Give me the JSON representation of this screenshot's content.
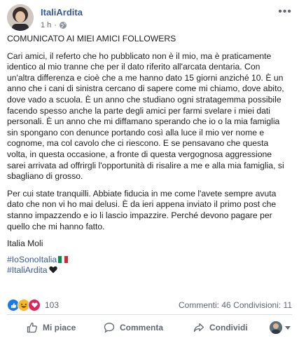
{
  "post": {
    "author": "ItaliArdita",
    "time": "1 h",
    "separator": "·",
    "headline": "COMUNICATO AI MIEI AMICI FOLLOWERS",
    "paragraph1": "Cari amici, il referto che ho pubblicato non è il mio, ma è praticamente identico al mio tranne che per il dato riferito all'arcata dentaria. Con un'altra differenza e cioè che a me hanno dato 15 giorni anziché 10. È un anno che i cani di sinistra cercano di sapere come mi chiamo, dove abito, dove vado a scuola. È un anno che studiano ogni stratagemma possibile facendo spesso anche la parte degli amici per farmi svelare i miei dati personali. È un anno che mi diffamano sperando che io o la mia famiglia sin spongano con denunce portando così alla luce il mio ver nome e cognome, ma col cavolo che ci riescono. E se pensavano che questa volta, in questa occasione, a fronte di questa vergognosa aggressione sarei arrivata ad offrirgli l'opportunità di risalire a me e alla mia famiglia, si sbagliano di grosso.",
    "paragraph2": "Per cui state tranquilli. Abbiate fiducia in me come l'avete sempre avuta dato che non vi ho mai delusi. È da ieri appena inviato il primo post che stanno impazzendo e io li lascio impazzire. Perché devono pagare per quello che mi hanno fatto.",
    "signature": "Italia Moli",
    "hashtags": [
      "#IoSonoItalia",
      "#ItaliArdita"
    ]
  },
  "stats": {
    "reactions_count": "103",
    "comments": "Commenti: 46",
    "shares": "Condivisioni: 11"
  },
  "actions": {
    "like": "Mi piace",
    "comment": "Commenta",
    "share": "Condividi"
  },
  "icons": {
    "more": "more-options-icon",
    "privacy": "globe-icon",
    "like": "thumbs-up-icon",
    "comment": "speech-bubble-icon",
    "share": "share-arrow-icon"
  },
  "colors": {
    "link": "#385898",
    "like_blue": "#1877f2",
    "text": "#1c1e21",
    "muted": "#616770"
  }
}
